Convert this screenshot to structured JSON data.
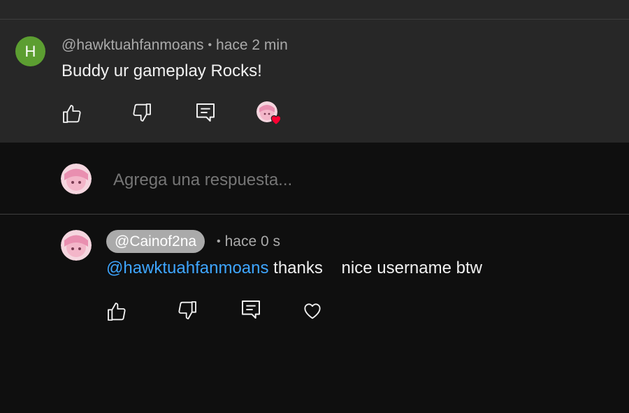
{
  "comment": {
    "avatar_letter": "H",
    "author": "@hawktuahfanmoans",
    "time": "hace 2 min",
    "text": "Buddy ur gameplay Rocks!",
    "avatar_color": "#5c9e31"
  },
  "reply_box": {
    "placeholder": "Agrega una respuesta..."
  },
  "reply": {
    "author": "@Cainof2na",
    "time": "hace 0 s",
    "mention": "@hawktuahfanmoans",
    "text": " thanks    nice username btw"
  },
  "icons": {
    "like": "thumb-up-icon",
    "dislike": "thumb-down-icon",
    "reply": "reply-icon",
    "heart": "heart-icon",
    "creator_heart": "creator-heart-icon"
  },
  "colors": {
    "background": "#0f0f0f",
    "comment_background": "#272727",
    "link": "#3ea6ff",
    "heart": "#ff0033"
  }
}
